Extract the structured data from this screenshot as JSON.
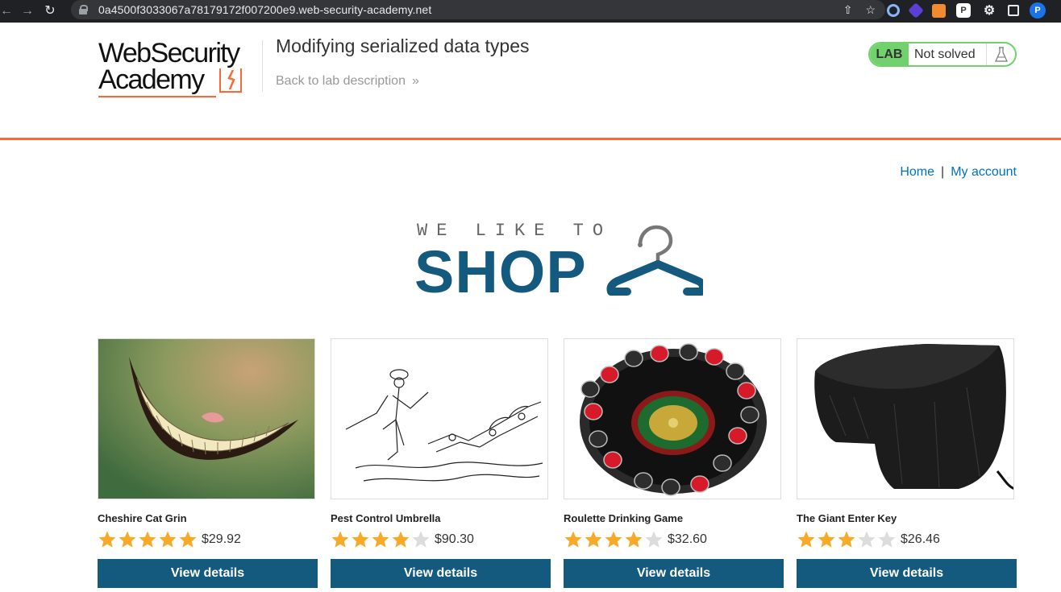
{
  "browser": {
    "url": "0a4500f3033067a78179172f007200e9.web-security-academy.net"
  },
  "header": {
    "logo_line1": "WebSecurity",
    "logo_line2": "Academy",
    "lab_title": "Modifying serialized data types",
    "back_link": "Back to lab description",
    "lab_badge": "LAB",
    "lab_status": "Not solved"
  },
  "nav": {
    "home": "Home",
    "separator": "|",
    "account": "My account"
  },
  "banner": {
    "tagline": "WE LIKE TO",
    "word": "SHOP"
  },
  "colors": {
    "accent": "#ff6633",
    "brand": "#135a7e",
    "lab_green": "#70d16d",
    "star": "#f7a928",
    "star_empty": "#dcdcdc"
  },
  "products": [
    {
      "name": "Cheshire Cat Grin",
      "rating": 5,
      "price": "$29.92",
      "button": "View details",
      "image": "cheshire-cat-grin-image"
    },
    {
      "name": "Pest Control Umbrella",
      "rating": 4,
      "price": "$90.30",
      "button": "View details",
      "image": "pest-control-umbrella-image"
    },
    {
      "name": "Roulette Drinking Game",
      "rating": 4,
      "price": "$32.60",
      "button": "View details",
      "image": "roulette-drinking-game-image"
    },
    {
      "name": "The Giant Enter Key",
      "rating": 3,
      "price": "$26.46",
      "button": "View details",
      "image": "giant-enter-key-image"
    }
  ]
}
